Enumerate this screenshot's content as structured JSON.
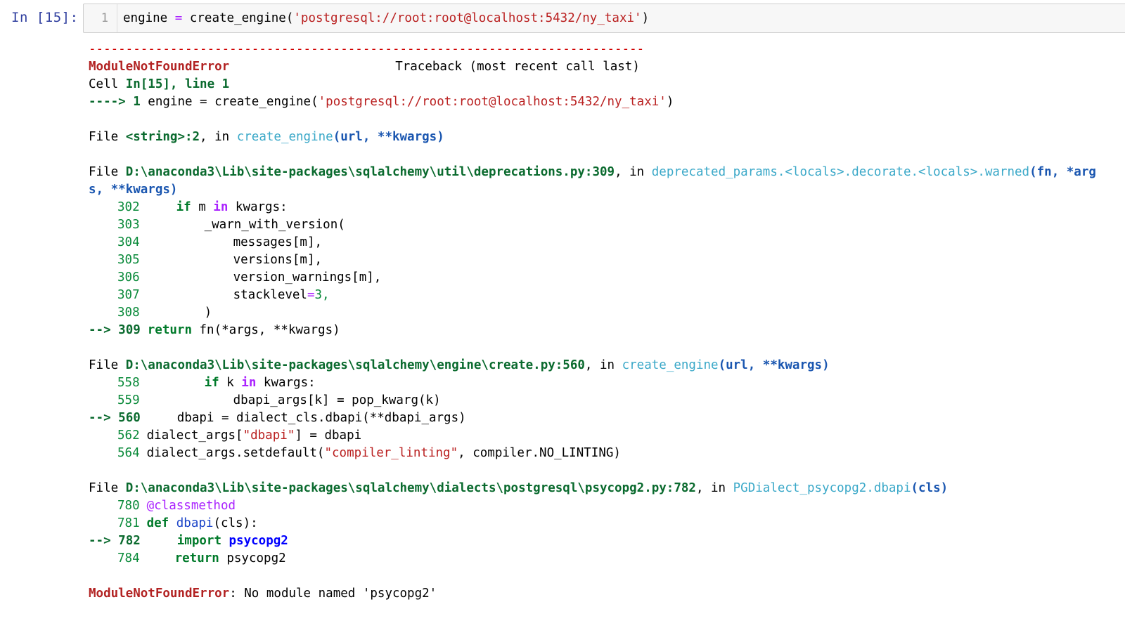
{
  "cell": {
    "prompt": "In  [15]:",
    "line_number": "1",
    "code": {
      "lhs": "engine ",
      "eq": "=",
      "call": " create_engine(",
      "q1": "'",
      "url": "postgresql://root:root@localhost:5432/ny_taxi",
      "q2": "'",
      "close": ")"
    }
  },
  "traceback": {
    "separator": "---------------------------------------------------------------------------",
    "error_name": "ModuleNotFoundError",
    "header_right": "Traceback (most recent call last)",
    "cell_ref": {
      "prefix": "Cell ",
      "ref": "In[15], line 1",
      "arrow": "----> 1 ",
      "code_a": "engine = create_engine(",
      "string": "'postgresql://root:root@localhost:5432/ny_taxi'",
      "code_b": ")"
    },
    "frames": [
      {
        "file_prefix": "File ",
        "file": "<string>:2",
        "in": ", in ",
        "func": "create_engine",
        "args": "(url, **kwargs)"
      },
      {
        "file_prefix": "File ",
        "file": "D:\\anaconda3\\Lib\\site-packages\\sqlalchemy\\util\\deprecations.py:309",
        "in": ", in ",
        "func": "deprecated_params.<locals>.decorate.<locals>.warned",
        "args": "(fn, *arg",
        "args_wrap": "s, **kwargs)"
      },
      {
        "file_prefix": "File ",
        "file": "D:\\anaconda3\\Lib\\site-packages\\sqlalchemy\\engine\\create.py:560",
        "in": ", in ",
        "func": "create_engine",
        "args": "(url, **kwargs)"
      },
      {
        "file_prefix": "File ",
        "file": "D:\\anaconda3\\Lib\\site-packages\\sqlalchemy\\dialects\\postgresql\\psycopg2.py:782",
        "in": ", in ",
        "func": "PGDialect_psycopg2.dbapi",
        "args": "(cls)"
      }
    ],
    "frame2_lines": {
      "l302": "302",
      "l302_kw": "if",
      "l302_a": " m ",
      "l302_in": "in",
      "l302_b": " kwargs:",
      "l303": "303",
      "l303_code": "_warn_with_version(",
      "l304": "304",
      "l304_code": "messages[m],",
      "l305": "305",
      "l305_code": "versions[m],",
      "l306": "306",
      "l306_code": "version_warnings[m],",
      "l307": "307",
      "l307_code": "stacklevel",
      "l307_eq": "=",
      "l307_val": "3,",
      "l308": "308",
      "l308_code": ")",
      "arrow": "--> ",
      "l309": "309",
      "l309_kw": "return",
      "l309_code": " fn(*args, **kwargs)"
    },
    "frame3_lines": {
      "l558": "558",
      "l558_kw": "if",
      "l558_a": " k ",
      "l558_in": "in",
      "l558_b": " kwargs:",
      "l559": "559",
      "l559_code": "dbapi_args[k] = pop_kwarg(k)",
      "arrow": "--> ",
      "l560": "560",
      "l560_code": "dbapi = dialect_cls.dbapi(**dbapi_args)",
      "l562": "562",
      "l562_a": "dialect_args[",
      "l562_str": "\"dbapi\"",
      "l562_b": "] = dbapi",
      "l564": "564",
      "l564_a": "dialect_args.setdefault(",
      "l564_str": "\"compiler_linting\"",
      "l564_b": ", compiler.NO_LINTING)"
    },
    "frame4_lines": {
      "l780": "780",
      "l780_deco": "@classmethod",
      "l781": "781",
      "l781_kw": "def",
      "l781_fn": " dbapi",
      "l781_b": "(cls):",
      "arrow": "--> ",
      "l782": "782",
      "l782_kw": "import",
      "l782_mod": " psycopg2",
      "l784": "784",
      "l784_kw": "return",
      "l784_b": " psycopg2"
    },
    "final": {
      "error_name": "ModuleNotFoundError",
      "message": ": No module named 'psycopg2'"
    }
  },
  "colors": {
    "prompt": "#303f9f",
    "error": "#b22222",
    "file_path": "#0a6a2e",
    "func_name": "#3aa8c8",
    "args": "#1a56b0",
    "string": "#ba2121"
  }
}
